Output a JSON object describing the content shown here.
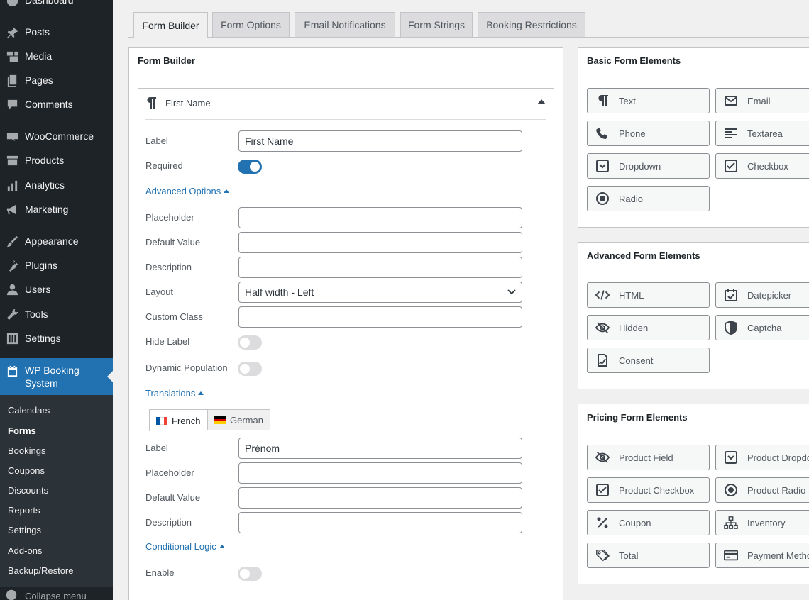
{
  "sidebar": {
    "menu": [
      {
        "label": "Dashboard",
        "icon": "dashboard-icon"
      },
      {
        "label": "Posts",
        "icon": "pin-icon"
      },
      {
        "label": "Media",
        "icon": "media-icon"
      },
      {
        "label": "Pages",
        "icon": "pages-icon"
      },
      {
        "label": "Comments",
        "icon": "comment-icon"
      },
      {
        "label": "WooCommerce",
        "icon": "woo-icon"
      },
      {
        "label": "Products",
        "icon": "archive-icon"
      },
      {
        "label": "Analytics",
        "icon": "bar-chart-icon"
      },
      {
        "label": "Marketing",
        "icon": "megaphone-icon"
      },
      {
        "label": "Appearance",
        "icon": "brush-icon"
      },
      {
        "label": "Plugins",
        "icon": "plug-icon"
      },
      {
        "label": "Users",
        "icon": "user-icon"
      },
      {
        "label": "Tools",
        "icon": "wrench-icon"
      },
      {
        "label": "Settings",
        "icon": "sliders-icon"
      }
    ],
    "active": {
      "label_line1": "WP Booking",
      "label_line2": "System",
      "icon": "calendar-icon"
    },
    "submenu": [
      "Calendars",
      "Forms",
      "Bookings",
      "Coupons",
      "Discounts",
      "Reports",
      "Settings",
      "Add-ons",
      "Backup/Restore"
    ],
    "submenu_current": "Forms",
    "collapse_label": "Collapse menu"
  },
  "tabs": [
    "Form Builder",
    "Form Options",
    "Email Notifications",
    "Form Strings",
    "Booking Restrictions"
  ],
  "active_tab": "Form Builder",
  "builder": {
    "title": "Form Builder",
    "field": {
      "title": "First Name",
      "label_label": "Label",
      "label_value": "First Name",
      "required_label": "Required",
      "required": true,
      "advanced_link": "Advanced Options",
      "placeholder_label": "Placeholder",
      "placeholder_value": "",
      "default_label": "Default Value",
      "default_value": "",
      "description_label": "Description",
      "description_value": "",
      "layout_label": "Layout",
      "layout_value": "Half width - Left",
      "custom_class_label": "Custom Class",
      "custom_class_value": "",
      "hide_label_label": "Hide Label",
      "hide_label": false,
      "dynamic_label": "Dynamic Population",
      "dynamic": false,
      "translations_link": "Translations",
      "languages": [
        "French",
        "German"
      ],
      "active_language": "French",
      "tr_label_label": "Label",
      "tr_label_value": "Prénom",
      "tr_placeholder_label": "Placeholder",
      "tr_default_label": "Default Value",
      "tr_description_label": "Description",
      "conditional_link": "Conditional Logic",
      "enable_label": "Enable",
      "enable": false
    }
  },
  "basic": {
    "title": "Basic Form Elements",
    "items": [
      {
        "label": "Text",
        "icon": "paragraph-icon"
      },
      {
        "label": "Email",
        "icon": "envelope-icon"
      },
      {
        "label": "Phone",
        "icon": "phone-icon"
      },
      {
        "label": "Textarea",
        "icon": "align-left-icon"
      },
      {
        "label": "Dropdown",
        "icon": "dropdown-icon"
      },
      {
        "label": "Checkbox",
        "icon": "checkbox-icon"
      },
      {
        "label": "Radio",
        "icon": "radio-icon"
      }
    ]
  },
  "advanced": {
    "title": "Advanced Form Elements",
    "items": [
      {
        "label": "HTML",
        "icon": "code-icon"
      },
      {
        "label": "Datepicker",
        "icon": "calendar-check-icon"
      },
      {
        "label": "Hidden",
        "icon": "eye-slash-icon"
      },
      {
        "label": "Captcha",
        "icon": "shield-icon"
      },
      {
        "label": "Consent",
        "icon": "signature-icon"
      }
    ]
  },
  "pricing": {
    "title": "Pricing Form Elements",
    "items": [
      {
        "label": "Product Field",
        "icon": "eye-slash-icon"
      },
      {
        "label": "Product Dropdown",
        "icon": "dropdown-icon"
      },
      {
        "label": "Product Checkbox",
        "icon": "checkbox-icon"
      },
      {
        "label": "Product Radio",
        "icon": "radio-icon"
      },
      {
        "label": "Coupon",
        "icon": "percent-icon"
      },
      {
        "label": "Inventory",
        "icon": "sitemap-icon"
      },
      {
        "label": "Total",
        "icon": "tags-icon"
      },
      {
        "label": "Payment Method",
        "icon": "credit-card-icon"
      }
    ]
  }
}
